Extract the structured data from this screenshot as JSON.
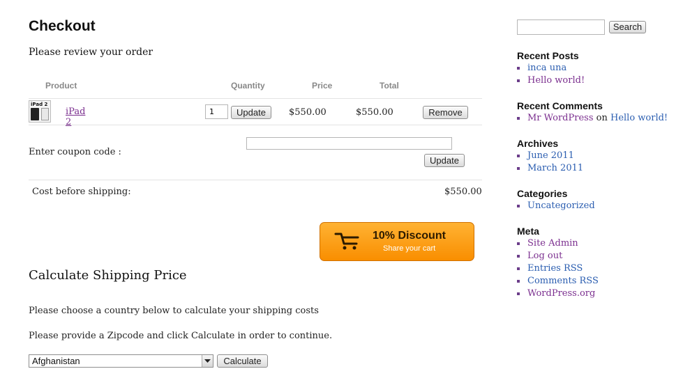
{
  "page": {
    "title": "Checkout",
    "review_text": "Please review your order"
  },
  "table": {
    "headers": {
      "product": "Product",
      "quantity": "Quantity",
      "price": "Price",
      "total": "Total"
    },
    "rows": [
      {
        "thumb_label": "iPad 2",
        "name": "iPad 2",
        "quantity": "1",
        "update_label": "Update",
        "price": "$550.00",
        "total": "$550.00",
        "remove_label": "Remove"
      }
    ]
  },
  "coupon": {
    "label": "Enter coupon code :",
    "value": "",
    "update_label": "Update"
  },
  "cost": {
    "label": "Cost before shipping:",
    "value": "$550.00"
  },
  "discount": {
    "title": "10% Discount",
    "subtitle": "Share your cart",
    "icon": "cart-icon"
  },
  "shipping": {
    "heading": "Calculate Shipping Price",
    "instruction1": "Please choose a country below to calculate your shipping costs",
    "instruction2": "Please provide a Zipcode and click Calculate in order to continue.",
    "country": "Afghanistan",
    "calculate_label": "Calculate"
  },
  "sidebar": {
    "search": {
      "value": "",
      "button": "Search"
    },
    "recent_posts": {
      "title": "Recent Posts",
      "items": [
        "inca una",
        "Hello world!"
      ]
    },
    "recent_comments": {
      "title": "Recent Comments",
      "author": "Mr WordPress",
      "on": "on",
      "post": "Hello world!"
    },
    "archives": {
      "title": "Archives",
      "items": [
        "June 2011",
        "March 2011"
      ]
    },
    "categories": {
      "title": "Categories",
      "items": [
        "Uncategorized"
      ]
    },
    "meta": {
      "title": "Meta",
      "items": [
        "Site Admin",
        "Log out",
        "Entries RSS",
        "Comments RSS",
        "WordPress.org"
      ]
    }
  },
  "colors": {
    "link": "#2a5db0",
    "visited": "#7b2f8f",
    "discount": "#f98e00"
  }
}
